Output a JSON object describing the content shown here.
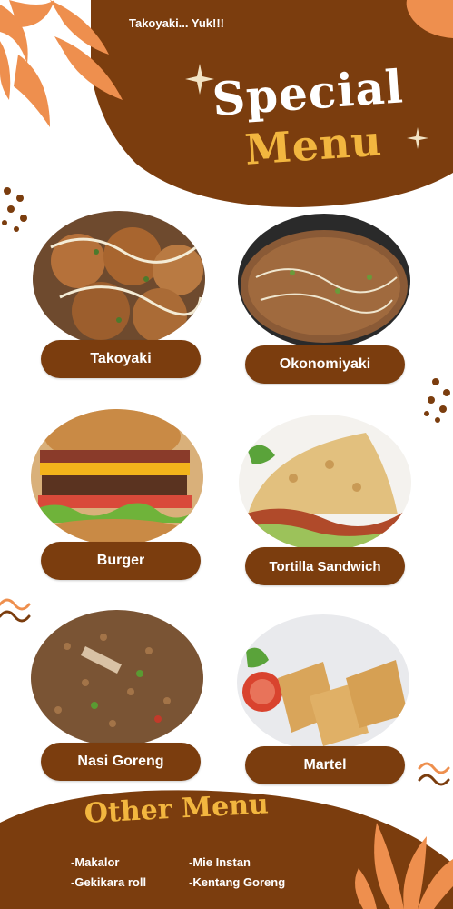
{
  "header": {
    "tagline": "Takoyaki... Yuk!!!",
    "title_line1": "Special",
    "title_line2": "Menu"
  },
  "menu_items": [
    {
      "label": "Takoyaki",
      "icon": "takoyaki-photo"
    },
    {
      "label": "Okonomiyaki",
      "icon": "okonomiyaki-photo"
    },
    {
      "label": "Burger",
      "icon": "burger-photo"
    },
    {
      "label": "Tortilla Sandwich",
      "icon": "tortilla-sandwich-photo"
    },
    {
      "label": "Nasi Goreng",
      "icon": "nasi-goreng-photo"
    },
    {
      "label": "Martel",
      "icon": "martel-photo"
    }
  ],
  "other_menu": {
    "title": "Other Menu",
    "items": [
      "-Makalor",
      "-Mie Instan",
      "-Gekikara roll",
      "-Kentang Goreng"
    ]
  },
  "colors": {
    "brown": "#7b3d0e",
    "orange": "#ee8f4e",
    "yellow": "#f2b63f",
    "white": "#ffffff"
  }
}
